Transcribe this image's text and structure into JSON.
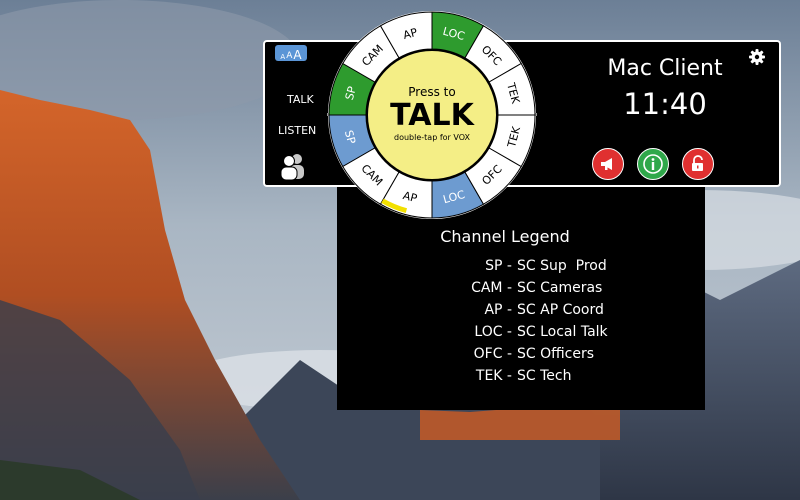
{
  "app": {
    "client_name": "Mac Client",
    "time": "11:40",
    "font_size_control": [
      "A",
      "A",
      "A"
    ],
    "talk_label": "TALK",
    "listen_label": "LISTEN"
  },
  "talk_button": {
    "line1": "Press to",
    "line2": "TALK",
    "line3": "double-tap for VOX"
  },
  "talk_ring": [
    {
      "label": "SP",
      "active": true
    },
    {
      "label": "CAM",
      "active": false
    },
    {
      "label": "AP",
      "active": false
    },
    {
      "label": "LOC",
      "active": true
    },
    {
      "label": "OFC",
      "active": false
    },
    {
      "label": "TEK",
      "active": false
    }
  ],
  "listen_ring": [
    {
      "label": "SP",
      "active": true
    },
    {
      "label": "CAM",
      "active": false
    },
    {
      "label": "AP",
      "active": false
    },
    {
      "label": "LOC",
      "active": true
    },
    {
      "label": "OFC",
      "active": false
    },
    {
      "label": "TEK",
      "active": false
    }
  ],
  "legend": {
    "title": "Channel Legend",
    "items": [
      {
        "code": "SP -",
        "name": "SC Sup  Prod"
      },
      {
        "code": "CAM -",
        "name": "SC Cameras"
      },
      {
        "code": "AP -",
        "name": "SC AP Coord"
      },
      {
        "code": "LOC -",
        "name": "SC Local Talk"
      },
      {
        "code": "OFC -",
        "name": "SC Officers"
      },
      {
        "code": "TEK -",
        "name": "SC Tech"
      }
    ]
  },
  "colors": {
    "talk_active": "#2e9b2e",
    "listen_active": "#6d9bd0",
    "talk_button": "#f4ee86",
    "alert_red": "#e03030",
    "info_green": "#2fa84a"
  },
  "icons": [
    "settings-gear-icon",
    "users-icon",
    "megaphone-icon",
    "info-icon",
    "unlock-icon"
  ]
}
